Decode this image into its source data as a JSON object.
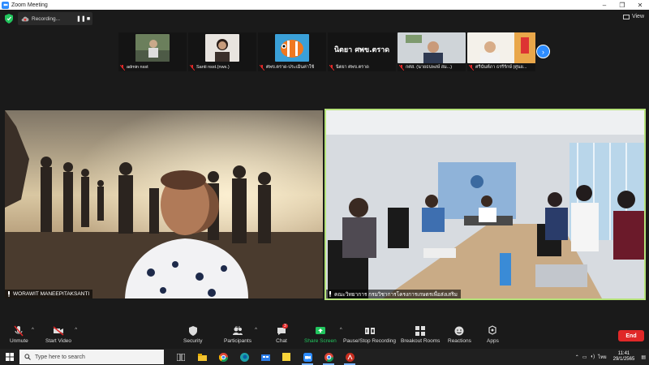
{
  "window": {
    "title": "Zoom Meeting"
  },
  "topbar": {
    "recording_label": "Recording...",
    "view_label": "View"
  },
  "participants_strip": [
    {
      "name": "admin nsst"
    },
    {
      "name": "Santi nsst.(nws.)"
    },
    {
      "name": "ศพข.ตราด-ประเมินค่าใช้"
    },
    {
      "name": "นิตยา ศพข.ตราด",
      "display_text": "นิตยา ศพข.ตราด"
    },
    {
      "name": "กศส. (นายธนพงษ์ สม...)"
    },
    {
      "name": "ศรีนันท์ภา ธรรีรักษ์ (ศูนย..."
    }
  ],
  "main_video_left": {
    "name": "WORAWIT MANEEPITAKSANTI"
  },
  "main_video_right": {
    "name": "คณะวิทยาการ กรมวิชาการโครงการเกษตรเพื่อส่งเสริม"
  },
  "toolbar": {
    "unmute": "Unmute",
    "start_video": "Start Video",
    "security": "Security",
    "participants": "Participants",
    "participants_count": "64",
    "chat": "Chat",
    "chat_badge": "3",
    "share_screen": "Share Screen",
    "pause_recording": "Pause/Stop Recording",
    "breakout": "Breakout Rooms",
    "reactions": "Reactions",
    "apps": "Apps",
    "end": "End"
  },
  "taskbar": {
    "search_placeholder": "Type here to search",
    "time": "11:41",
    "date": "29/1/2565",
    "lang": "ไทย"
  },
  "colors": {
    "accent": "#2d8cff",
    "end": "#e02828",
    "active_speaker": "#b6e37a",
    "share": "#22c55e"
  }
}
